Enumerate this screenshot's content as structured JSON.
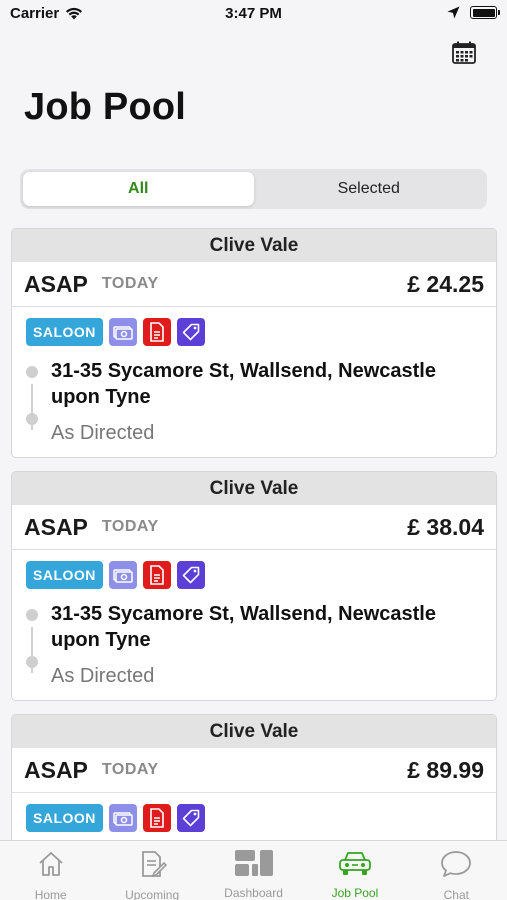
{
  "status_bar": {
    "carrier": "Carrier",
    "time": "3:47 PM"
  },
  "page": {
    "title": "Job Pool"
  },
  "segment": {
    "options": [
      "All",
      "Selected"
    ],
    "selected": "All"
  },
  "jobs": [
    {
      "passenger": "Clive Vale",
      "when": "ASAP",
      "day": "TODAY",
      "price": "£ 24.25",
      "vehicle": "SALOON",
      "pickup": "31-35 Sycamore St, Wallsend, Newcastle upon Tyne",
      "dropoff": "As Directed"
    },
    {
      "passenger": "Clive Vale",
      "when": "ASAP",
      "day": "TODAY",
      "price": "£ 38.04",
      "vehicle": "SALOON",
      "pickup": "31-35 Sycamore St, Wallsend, Newcastle upon Tyne",
      "dropoff": "As Directed"
    },
    {
      "passenger": "Clive Vale",
      "when": "ASAP",
      "day": "TODAY",
      "price": "£ 89.99",
      "vehicle": "SALOON",
      "pickup": "",
      "dropoff": ""
    }
  ],
  "tab_bar": {
    "items": [
      {
        "label": "Home",
        "icon": "home-icon"
      },
      {
        "label": "Upcoming",
        "icon": "upcoming-icon"
      },
      {
        "label": "Dashboard",
        "icon": "dashboard-icon"
      },
      {
        "label": "Job Pool",
        "icon": "car-icon"
      },
      {
        "label": "Chat",
        "icon": "chat-icon"
      }
    ],
    "active": "Job Pool"
  },
  "colors": {
    "accent": "#35a51f",
    "vehicle_tag": "#35a6da",
    "cash_tag": "#8d8fe8",
    "doc_tag": "#e01b1b",
    "price_tag": "#5b3fd6"
  }
}
